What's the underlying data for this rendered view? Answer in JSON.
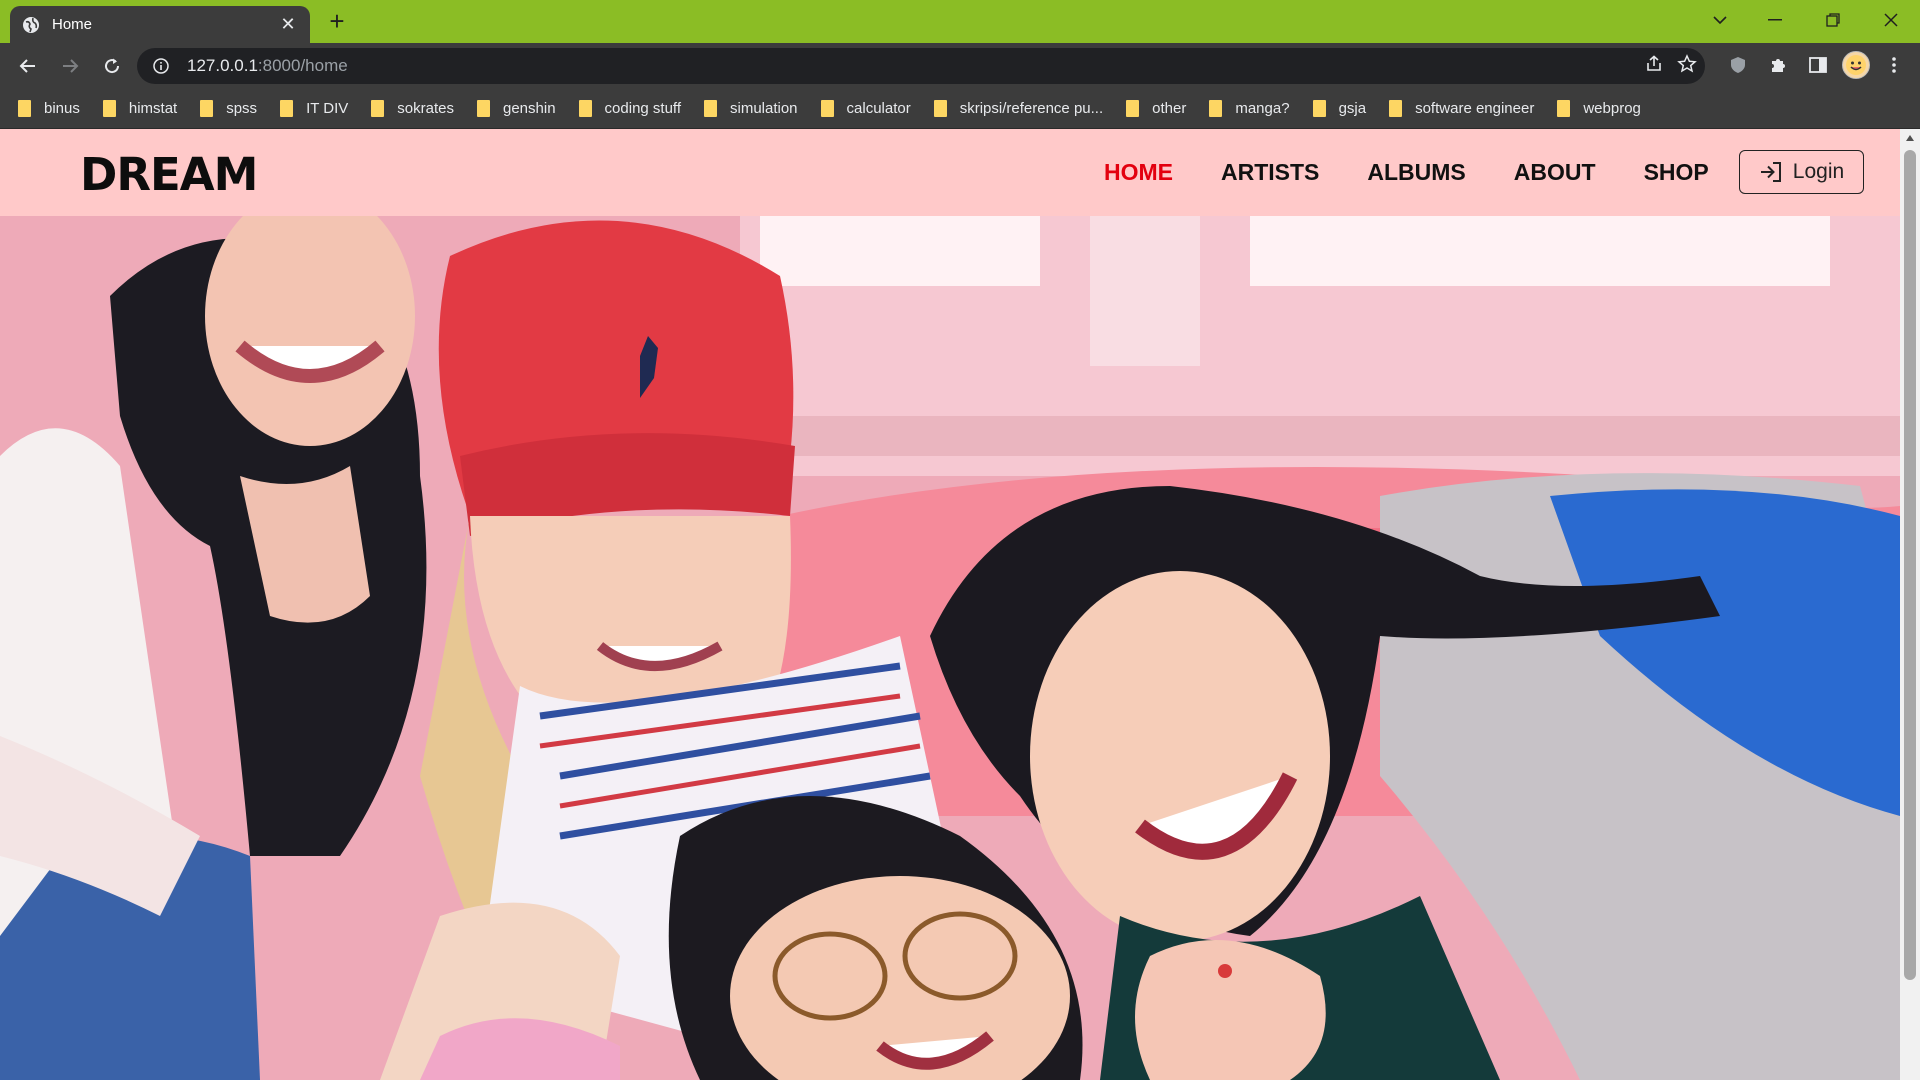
{
  "browser": {
    "tab": {
      "title": "Home",
      "favicon": "globe-icon"
    },
    "url": {
      "host": "127.0.0.1",
      "path": ":8000/home"
    },
    "bookmarks": [
      "binus",
      "himstat",
      "spss",
      "IT DIV",
      "sokrates",
      "genshin",
      "coding stuff",
      "simulation",
      "calculator",
      "skripsi/reference pu...",
      "other",
      "manga?",
      "gsja",
      "software engineer",
      "webprog"
    ],
    "accent_color": "#8bbd25"
  },
  "site": {
    "logo": "DREAM",
    "nav": [
      "HOME",
      "ARTISTS",
      "ALBUMS",
      "ABOUT",
      "SHOP"
    ],
    "active_nav": "HOME",
    "login_label": "Login",
    "nav_bg": "#ffc9c9",
    "active_color": "#e3000f"
  }
}
